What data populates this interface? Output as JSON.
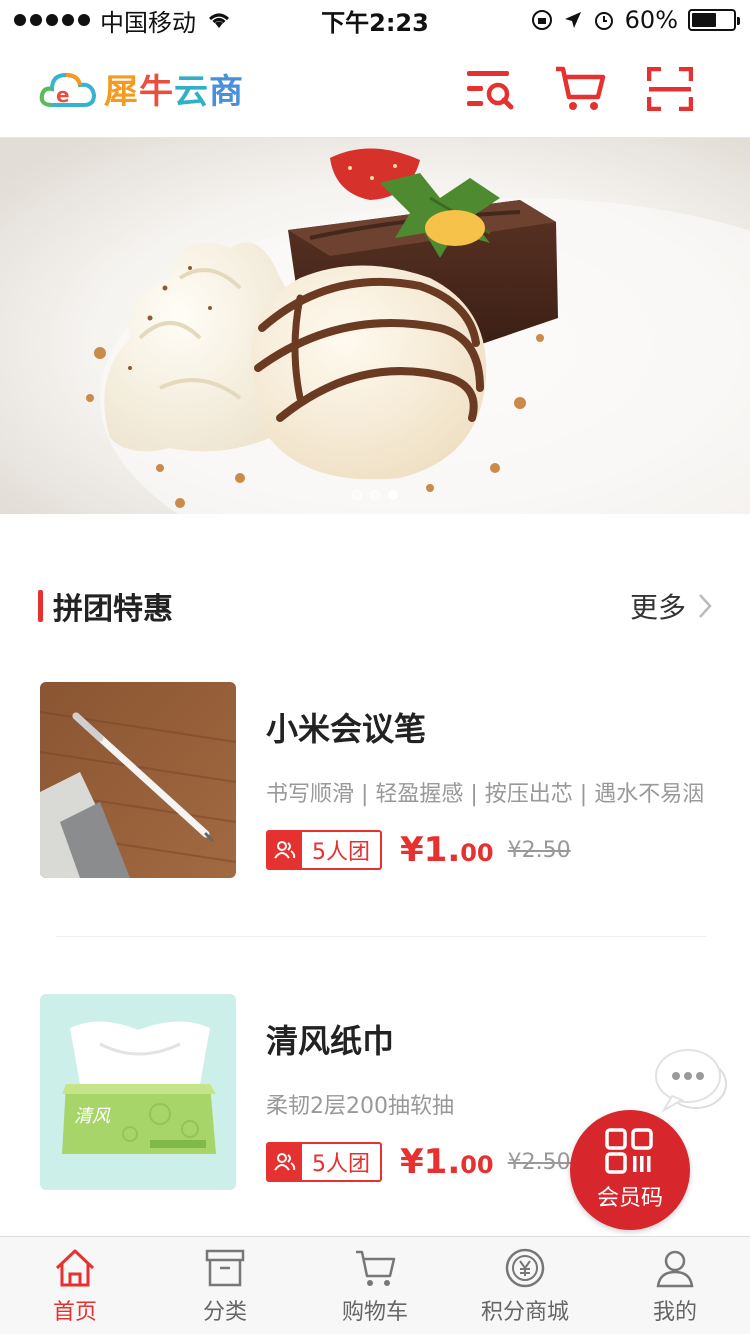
{
  "status_bar": {
    "carrier": "中国移动",
    "time": "下午2:23",
    "battery": "60%",
    "battery_level": 0.6
  },
  "header": {
    "logo_text": [
      "犀",
      "牛",
      "云",
      "商"
    ],
    "icons": [
      "search-menu-icon",
      "cart-icon",
      "scan-icon"
    ]
  },
  "banner": {
    "slide_count": 3,
    "active_slide": 3
  },
  "section": {
    "title": "拼团特惠",
    "more_label": "更多"
  },
  "products": [
    {
      "name": "小米会议笔",
      "desc": "书写顺滑 | 轻盈握感 | 按压出芯 | 遇水不易洇",
      "group_label": "5人团",
      "price_int": "¥1.",
      "price_dec": "00",
      "orig_price": "¥2.50"
    },
    {
      "name": "清风纸巾",
      "desc": "柔韧2层200抽软抽",
      "group_label": "5人团",
      "price_int": "¥1.",
      "price_dec": "00",
      "orig_price": "¥2.50"
    }
  ],
  "floating": {
    "member_code_label": "会员码"
  },
  "tab_bar": {
    "tabs": [
      {
        "label": "首页",
        "icon": "home-icon",
        "active": true
      },
      {
        "label": "分类",
        "icon": "box-icon",
        "active": false
      },
      {
        "label": "购物车",
        "icon": "cart-icon",
        "active": false
      },
      {
        "label": "积分商城",
        "icon": "yen-coin-icon",
        "active": false
      },
      {
        "label": "我的",
        "icon": "user-icon",
        "active": false
      }
    ]
  },
  "colors": {
    "accent": "#e5312f",
    "member_button": "#d8262d"
  }
}
